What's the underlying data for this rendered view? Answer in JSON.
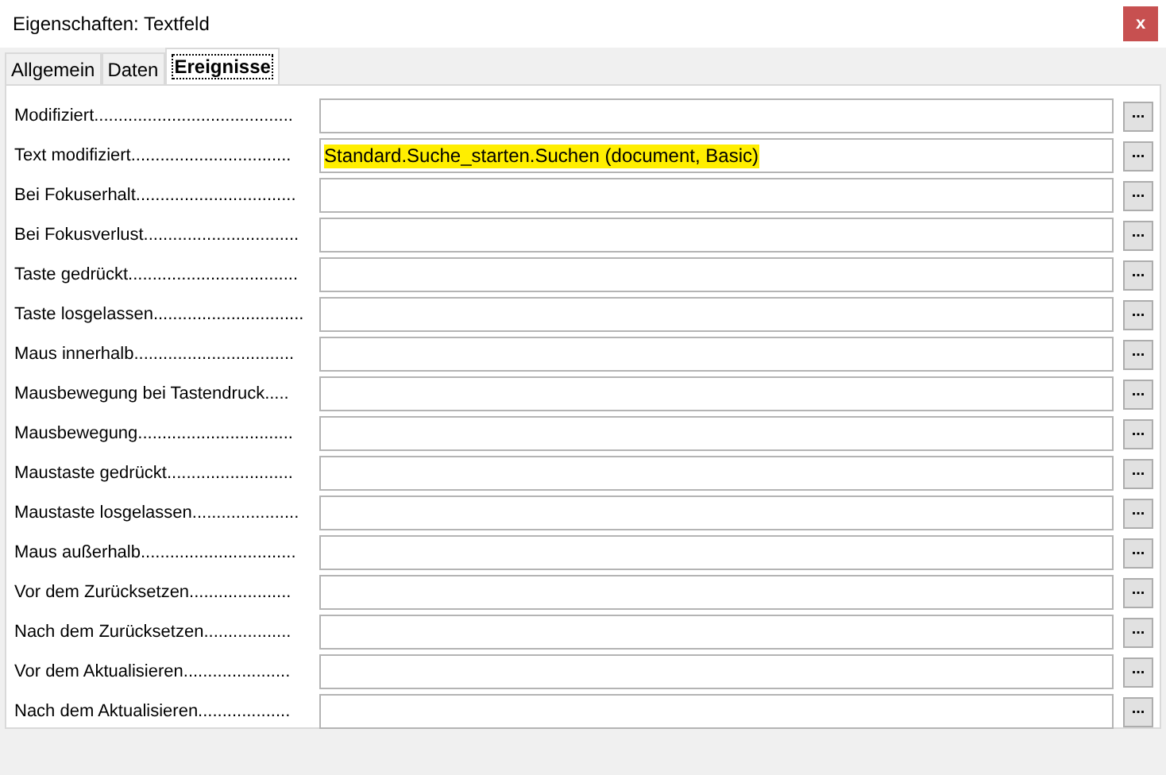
{
  "window": {
    "title": "Eigenschaften: Textfeld",
    "close": "x"
  },
  "tabs": [
    {
      "label": "Allgemein",
      "selected": false
    },
    {
      "label": "Daten",
      "selected": false
    },
    {
      "label": "Ereignisse",
      "selected": true
    }
  ],
  "events": [
    {
      "label": "Modifiziert.........................................",
      "button": "..."
    },
    {
      "label": "Text modifiziert.................................",
      "value": "Standard.Suche_starten.Suchen (document, Basic)",
      "button": "..."
    },
    {
      "label": "Bei Fokuserhalt.................................",
      "button": "..."
    },
    {
      "label": "Bei Fokusverlust................................",
      "button": "..."
    },
    {
      "label": "Taste gedrückt...................................",
      "button": "..."
    },
    {
      "label": "Taste losgelassen...............................",
      "button": "..."
    },
    {
      "label": "Maus innerhalb.................................",
      "button": "..."
    },
    {
      "label": "Mausbewegung bei Tastendruck.....",
      "button": "..."
    },
    {
      "label": "Mausbewegung................................",
      "button": "..."
    },
    {
      "label": "Maustaste gedrückt..........................",
      "button": "..."
    },
    {
      "label": "Maustaste losgelassen......................",
      "button": "..."
    },
    {
      "label": "Maus außerhalb................................",
      "button": "..."
    },
    {
      "label": "Vor dem Zurücksetzen.....................",
      "button": "..."
    },
    {
      "label": "Nach dem Zurücksetzen..................",
      "button": "..."
    },
    {
      "label": "Vor dem Aktualisieren......................",
      "button": "..."
    },
    {
      "label": "Nach dem Aktualisieren...................",
      "button": "..."
    }
  ]
}
